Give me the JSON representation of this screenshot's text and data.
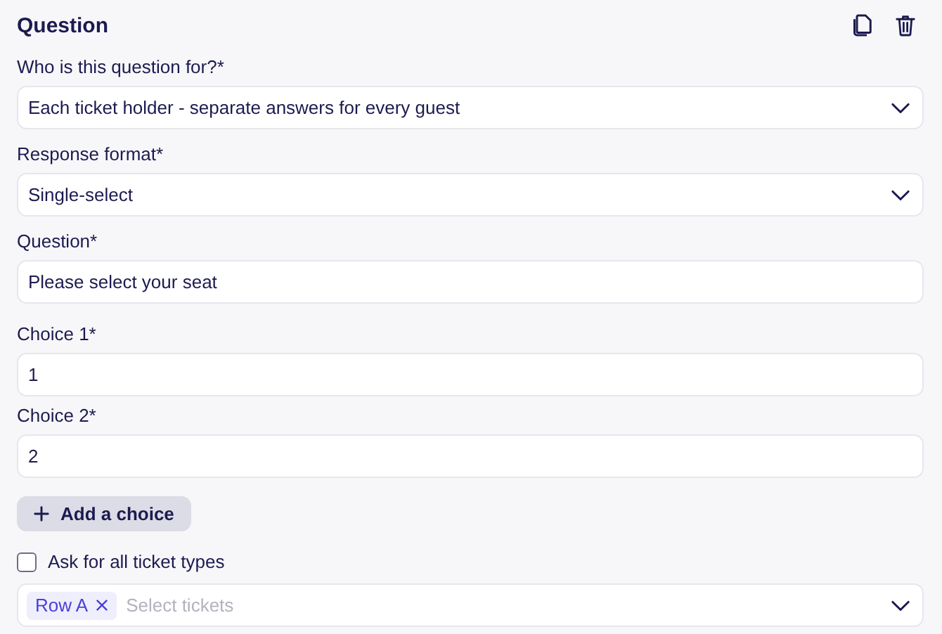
{
  "header": {
    "title": "Question"
  },
  "fields": [
    {
      "kind": "select",
      "label": "Who is this question for?*",
      "value": "Each ticket holder - separate answers for every guest"
    },
    {
      "kind": "select",
      "label": "Response format*",
      "value": "Single-select"
    },
    {
      "kind": "text",
      "label": "Question*",
      "value": "Please select your seat"
    }
  ],
  "choices": [
    {
      "label": "Choice 1*",
      "value": "1"
    },
    {
      "label": "Choice 2*",
      "value": "2"
    }
  ],
  "add_button": "Add a choice",
  "ask_all": {
    "label": "Ask for all ticket types",
    "checked": false
  },
  "tickets": {
    "tags": [
      "Row A"
    ],
    "placeholder": "Select tickets"
  }
}
